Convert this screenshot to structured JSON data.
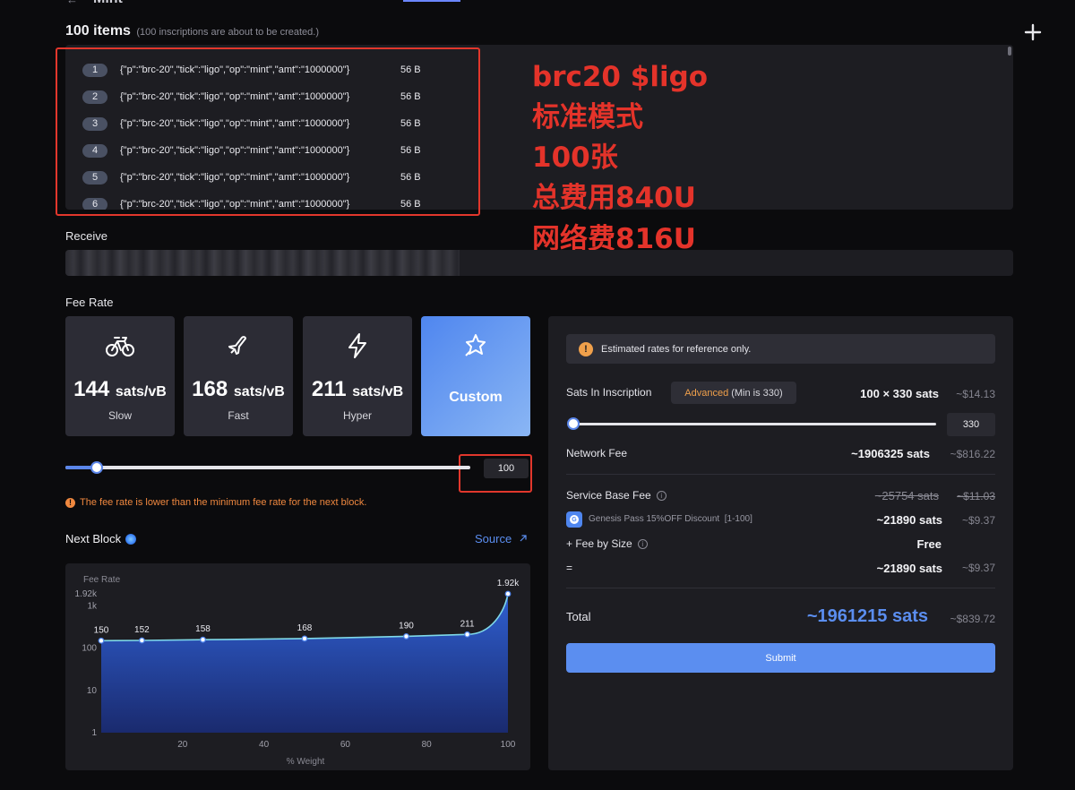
{
  "header": {
    "back_symbol": "←",
    "title": "Mint"
  },
  "items": {
    "title": "100 items",
    "subtitle": "(100 inscriptions are about to be created.)",
    "rows": [
      {
        "num": "1",
        "content": "{\"p\":\"brc-20\",\"tick\":\"ligo\",\"op\":\"mint\",\"amt\":\"1000000\"}",
        "size": "56 B"
      },
      {
        "num": "2",
        "content": "{\"p\":\"brc-20\",\"tick\":\"ligo\",\"op\":\"mint\",\"amt\":\"1000000\"}",
        "size": "56 B"
      },
      {
        "num": "3",
        "content": "{\"p\":\"brc-20\",\"tick\":\"ligo\",\"op\":\"mint\",\"amt\":\"1000000\"}",
        "size": "56 B"
      },
      {
        "num": "4",
        "content": "{\"p\":\"brc-20\",\"tick\":\"ligo\",\"op\":\"mint\",\"amt\":\"1000000\"}",
        "size": "56 B"
      },
      {
        "num": "5",
        "content": "{\"p\":\"brc-20\",\"tick\":\"ligo\",\"op\":\"mint\",\"amt\":\"1000000\"}",
        "size": "56 B"
      },
      {
        "num": "6",
        "content": "{\"p\":\"brc-20\",\"tick\":\"ligo\",\"op\":\"mint\",\"amt\":\"1000000\"}",
        "size": "56 B"
      }
    ]
  },
  "annotation": {
    "lines": [
      "brc20 $ligo",
      "标准模式",
      "100张",
      "总费用840U",
      "网络费816U"
    ],
    "color": "#e4332a"
  },
  "receive": {
    "label": "Receive"
  },
  "fee_rate": {
    "label": "Fee Rate",
    "options": [
      {
        "value": "144",
        "unit": "sats/vB",
        "name": "Slow",
        "icon": "bicycle-icon"
      },
      {
        "value": "168",
        "unit": "sats/vB",
        "name": "Fast",
        "icon": "airplane-icon"
      },
      {
        "value": "211",
        "unit": "sats/vB",
        "name": "Hyper",
        "icon": "lightning-icon"
      },
      {
        "value": "",
        "unit": "",
        "name": "Custom",
        "icon": "rocket-star-icon"
      }
    ],
    "custom_value": "100",
    "slider_fraction": 0.07,
    "warning": "The fee rate is lower than the minimum fee rate for the next block."
  },
  "next_block": {
    "title": "Next Block",
    "source_label": "Source",
    "source_icon": "external-arrow-icon"
  },
  "chart_data": {
    "type": "area",
    "title": "",
    "ylabel": "Fee Rate",
    "xlabel": "% Weight",
    "y_scale": "log",
    "ylim": [
      1,
      1920
    ],
    "y_ticks": [
      "1.92k",
      "1k",
      "100",
      "10",
      "1"
    ],
    "y_tick_values": [
      1920,
      1000,
      100,
      10,
      1
    ],
    "x_ticks": [
      "20",
      "40",
      "60",
      "80",
      "100"
    ],
    "x_tick_values": [
      20,
      40,
      60,
      80,
      100
    ],
    "xlim": [
      0,
      100
    ],
    "points": [
      {
        "x": 0,
        "y": 150,
        "label": "150"
      },
      {
        "x": 10,
        "y": 152,
        "label": "152"
      },
      {
        "x": 25,
        "y": 158,
        "label": "158"
      },
      {
        "x": 50,
        "y": 168,
        "label": "168"
      },
      {
        "x": 75,
        "y": 190,
        "label": "190"
      },
      {
        "x": 90,
        "y": 211,
        "label": "211"
      },
      {
        "x": 100,
        "y": 1920,
        "label": "1.92k"
      }
    ],
    "colors": {
      "line": "#7fd9e8",
      "fill_top": "#2f5fd0",
      "fill_bottom": "#1a2a6e"
    }
  },
  "summary": {
    "notice": "Estimated rates for reference only.",
    "sats_in_inscription": {
      "label": "Sats In Inscription",
      "advanced": "Advanced",
      "min_note": "(Min is 330)",
      "value": "100 × 330 sats",
      "usd": "~$14.13",
      "input": "330",
      "slider_fraction": 0
    },
    "network_fee": {
      "label": "Network Fee",
      "value": "~1906325 sats",
      "usd": "~$816.22"
    },
    "service_base_fee": {
      "label": "Service Base Fee",
      "value": "~25754 sats",
      "usd": "~$11.03"
    },
    "discount": {
      "label": "Genesis Pass 15%OFF Discount",
      "range": "[1-100]",
      "value": "~21890 sats",
      "usd": "~$9.37"
    },
    "fee_by_size": {
      "label": "+ Fee by Size",
      "value": "Free"
    },
    "equals": {
      "label": "=",
      "value": "~21890 sats",
      "usd": "~$9.37"
    },
    "total": {
      "label": "Total",
      "value": "~1961215 sats",
      "usd": "~$839.72"
    },
    "submit_label": "Submit"
  }
}
